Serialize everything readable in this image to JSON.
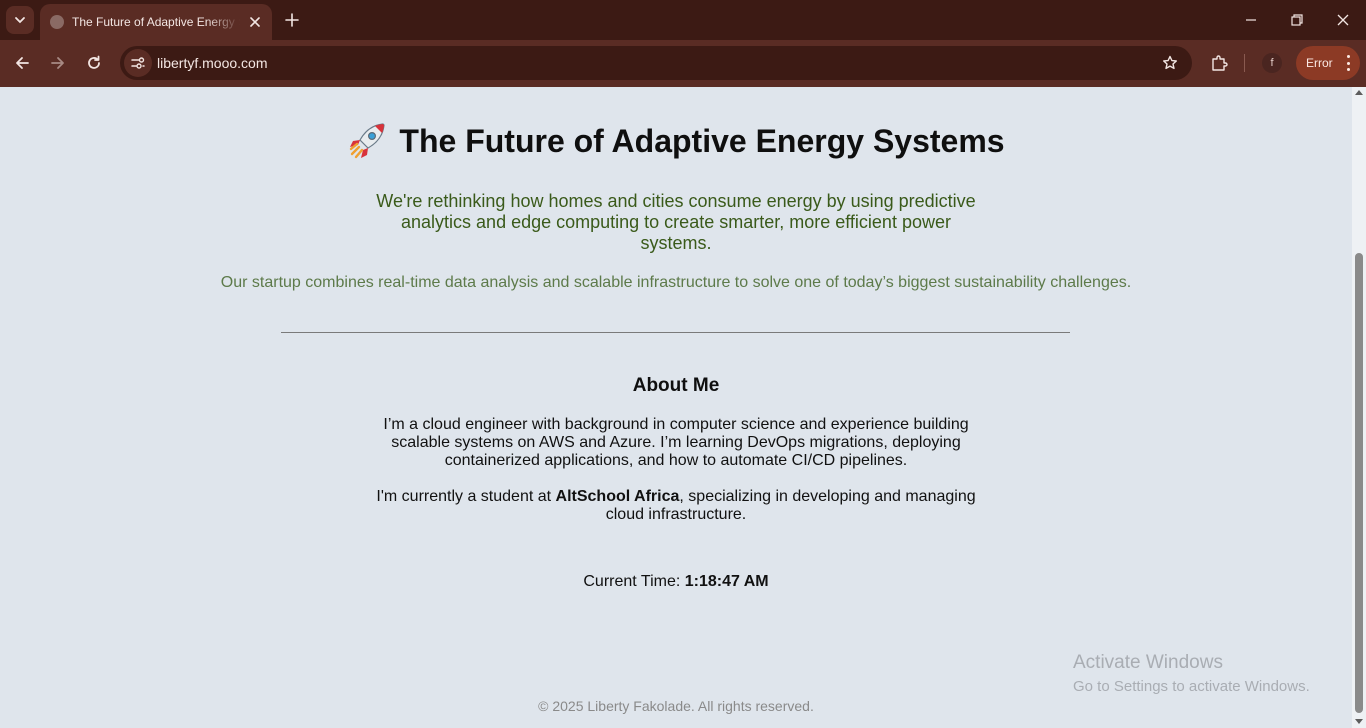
{
  "browser": {
    "tab_title": "The Future of Adaptive Energy Systems",
    "url": "libertyf.mooo.com",
    "profile_initial": "f",
    "error_label": "Error"
  },
  "page": {
    "title": "The Future of Adaptive Energy Systems",
    "tagline": "We're rethinking how homes and cities consume energy by using predictive analytics and edge computing to create smarter, more efficient power systems.",
    "subtext": "Our startup combines real-time data analysis and scalable infrastructure to solve one of today’s biggest sustainability challenges.",
    "about_title": "About Me",
    "about_p1": "I’m a cloud engineer with background in computer science and experience building scalable systems on AWS and Azure. I’m learning DevOps migrations, deploying containerized applications, and how to automate CI/CD pipelines.",
    "about_p2_prefix": "I'm currently a student at ",
    "about_p2_school": "AltSchool Africa",
    "about_p2_suffix": ", specializing in developing and managing cloud infrastructure.",
    "time_label": "Current Time: ",
    "time_value": "1:18:47 AM",
    "footer": "© 2025 Liberty Fakolade. All rights reserved."
  },
  "overlay": {
    "activate_title": "Activate Windows",
    "activate_sub": "Go to Settings to activate Windows."
  },
  "colors": {
    "chrome_dark": "#3c1a14",
    "chrome_mid": "#5a2c24",
    "page_bg": "#dfe5ec",
    "tagline": "#3a5a1a",
    "subtext": "#5d7a4a",
    "error_btn": "#8c3a25"
  },
  "icons": [
    "tab-search-icon",
    "globe-favicon-icon",
    "close-icon",
    "plus-icon",
    "minimize-icon",
    "restore-icon",
    "window-close-icon",
    "back-arrow-icon",
    "forward-arrow-icon",
    "reload-icon",
    "site-info-icon",
    "star-icon",
    "extensions-icon",
    "more-vert-icon",
    "rocket-icon"
  ]
}
